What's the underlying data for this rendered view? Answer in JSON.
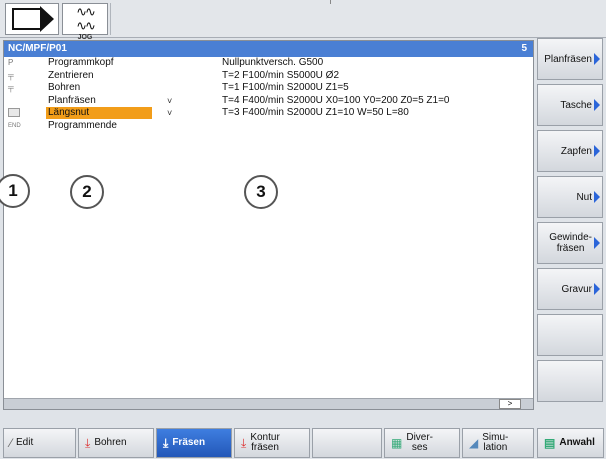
{
  "topbar": {
    "mode_icon": "play-arrow-icon",
    "jog_label": "JOG"
  },
  "editor": {
    "path": "NC/MPF/P01",
    "block_count": "5",
    "rows": [
      {
        "icon": "P",
        "name": "Programmkopf",
        "chevron": "",
        "params": "Nullpunktversch. G500",
        "selected": false
      },
      {
        "icon": "drill-icon",
        "name": "Zentrieren",
        "chevron": "",
        "params": "T=2 F100/min S5000U Ø2",
        "selected": false
      },
      {
        "icon": "drill-icon",
        "name": "Bohren",
        "chevron": "",
        "params": "T=1 F100/min S2000U Z1=5",
        "selected": false
      },
      {
        "icon": "",
        "name": "Planfräsen",
        "chevron": "˅",
        "params": "T=4 F400/min S2000U X0=100 Y0=200 Z0=5 Z1=0",
        "selected": false
      },
      {
        "icon": "slot-icon",
        "name": "Längsnut",
        "chevron": "˅",
        "params": "T=3 F400/min S2000U Z1=10 W=50 L=80",
        "selected": true
      },
      {
        "icon": "END",
        "name": "Programmende",
        "chevron": "",
        "params": "",
        "selected": false
      }
    ],
    "callouts": [
      "1",
      "2",
      "3"
    ],
    "more_label": ">"
  },
  "vertical_softkeys": [
    {
      "label": "Planfräsen"
    },
    {
      "label": "Tasche"
    },
    {
      "label": "Zapfen"
    },
    {
      "label": "Nut"
    },
    {
      "label": "Gewinde-\nfräsen"
    },
    {
      "label": "Gravur"
    },
    {
      "label": ""
    },
    {
      "label": ""
    }
  ],
  "horizontal_softkeys": [
    {
      "label": "Edit"
    },
    {
      "label": "Bohren"
    },
    {
      "label": "Fräsen"
    },
    {
      "label": "Kontur\nfräsen"
    },
    {
      "label": ""
    },
    {
      "label": "Diver-\nses"
    },
    {
      "label": "Simu-\nlation"
    },
    {
      "label": "Anwahl"
    }
  ],
  "colors": {
    "header_blue": "#4a7fd4",
    "selection_orange": "#f29d19",
    "active_softkey": "#2f6ad0",
    "arrow_blue": "#2b65d9"
  }
}
